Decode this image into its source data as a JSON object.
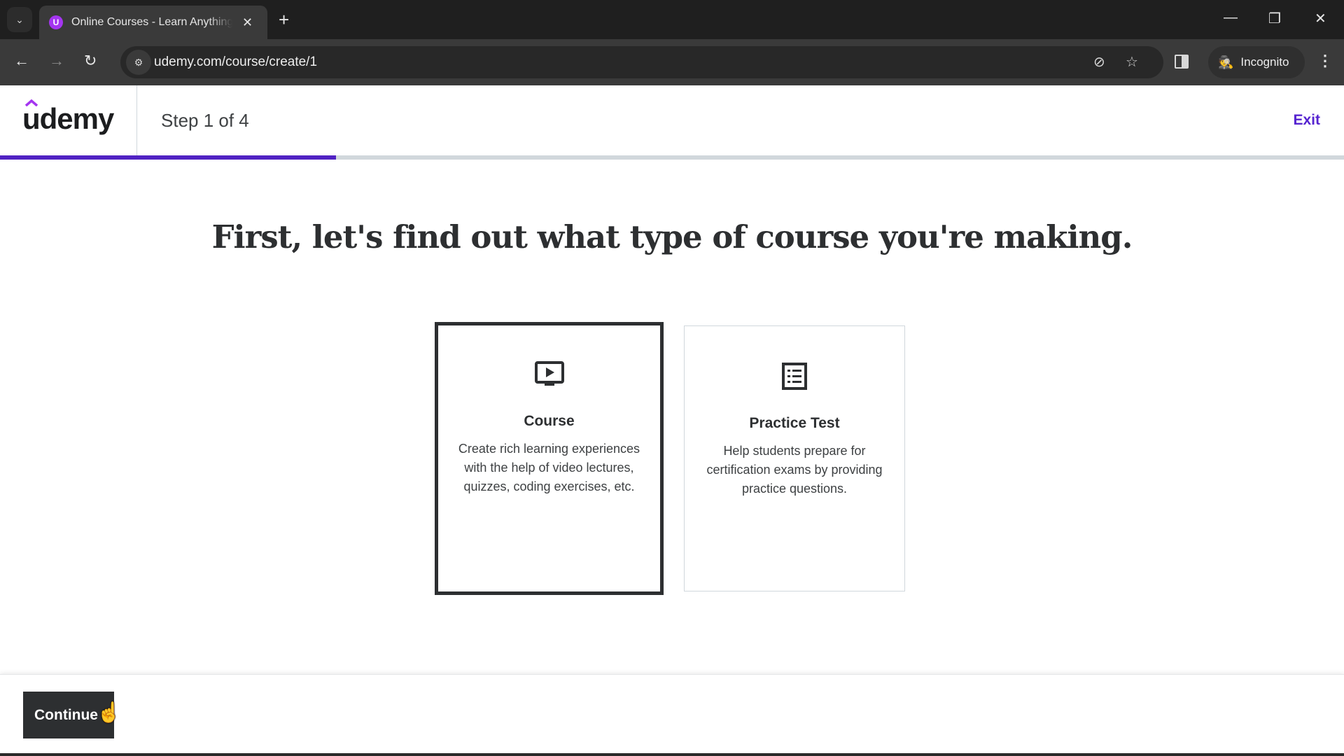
{
  "browser": {
    "tab": {
      "title": "Online Courses - Learn Anything",
      "favicon_letter": "U",
      "close_glyph": "✕"
    },
    "tab_search_glyph": "⌄",
    "new_tab_glyph": "+",
    "window_controls": {
      "minimize": "—",
      "restore": "❐",
      "close": "✕"
    },
    "nav": {
      "back": "←",
      "forward": "→",
      "reload": "↻"
    },
    "url": "udemy.com/course/create/1",
    "site_info_glyph": "⚙",
    "omnibox_icons": {
      "tracking_protection": "⊘",
      "bookmark": "☆"
    },
    "incognito_label": "Incognito",
    "incognito_glyph": "🕵",
    "menu_glyph": "⋮"
  },
  "header": {
    "logo": "udemy",
    "step_label": "Step 1 of 4",
    "exit_label": "Exit",
    "progress_percent": 25
  },
  "main": {
    "heading": "First, let's find out what type of course you're making.",
    "options": [
      {
        "title": "Course",
        "description": "Create rich learning experiences with the help of video lectures, quizzes, coding exercises, etc.",
        "icon": "video-screen-icon",
        "selected": true
      },
      {
        "title": "Practice Test",
        "description": "Help students prepare for certification exams by providing practice questions.",
        "icon": "list-doc-icon",
        "selected": false
      }
    ]
  },
  "footer": {
    "continue_label": "Continue"
  },
  "colors": {
    "brand_purple": "#a435f0",
    "link_purple": "#5624d0",
    "progress_purple": "#5022c3",
    "dark": "#2d2f31"
  }
}
